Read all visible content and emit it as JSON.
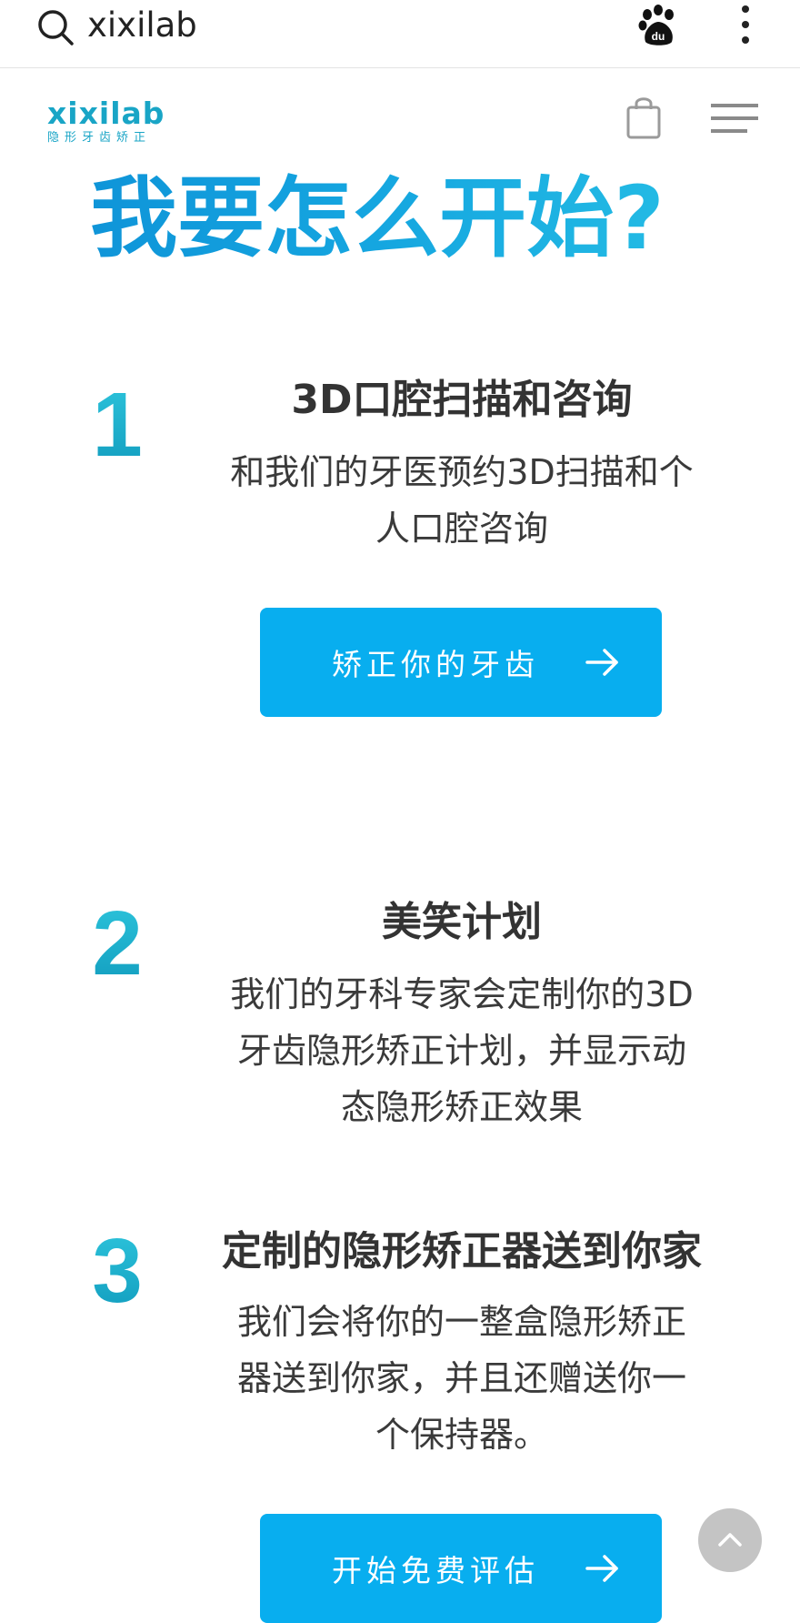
{
  "browser": {
    "query": "xixilab"
  },
  "site": {
    "logo_word": "xixilab",
    "logo_sub": "隐形牙齿矫正"
  },
  "hero": {
    "title": "我要怎么开始?"
  },
  "steps": [
    {
      "number": "1",
      "title": "3D口腔扫描和咨询",
      "desc_line1": "和我们的牙医预约3D扫描和个",
      "desc_line2": "人口腔咨询"
    },
    {
      "number": "2",
      "title": "美笑计划",
      "desc_line1": "我们的牙科专家会定制你的3D",
      "desc_line2": "牙齿隐形矫正计划，并显示动",
      "desc_line3": "态隐形矫正效果"
    },
    {
      "number": "3",
      "title": "定制的隐形矫正器送到你家",
      "desc_line1": "我们会将你的一整盒隐形矫正",
      "desc_line2": "器送到你家，并且还赠送你一",
      "desc_line3": "个保持器。"
    }
  ],
  "buttons": {
    "straighten": "矫正你的牙齿",
    "assessment": "开始免费评估"
  },
  "colors": {
    "accent": "#08aeef",
    "brand": "#19a5c6"
  }
}
